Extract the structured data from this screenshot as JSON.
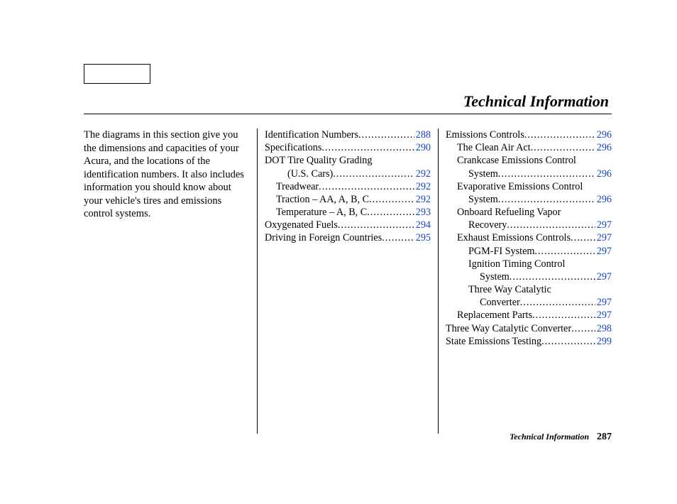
{
  "header": {
    "title": "Technical Information"
  },
  "intro": "The diagrams in this section give you the dimensions and capacities of your Acura, and the locations of the identification numbers. It also includes information you should know about your vehicle's tires and emissions control systems.",
  "col2": [
    {
      "label": "Identification Numbers",
      "page": "288",
      "indent": 0,
      "dots": true
    },
    {
      "label": "Specifications",
      "page": "290",
      "indent": 0,
      "dots": true
    },
    {
      "label": "DOT Tire Quality Grading",
      "page": "",
      "indent": 0,
      "dots": false
    },
    {
      "label": "(U.S. Cars)",
      "page": "292",
      "indent": 2,
      "dots": true
    },
    {
      "label": "Treadwear",
      "page": "292",
      "indent": 1,
      "dots": true
    },
    {
      "label": "Traction – AA, A, B, C",
      "page": "292",
      "indent": 1,
      "dots": true
    },
    {
      "label": "Temperature – A, B, C",
      "page": "293",
      "indent": 1,
      "dots": true
    },
    {
      "label": "Oxygenated Fuels",
      "page": "294",
      "indent": 0,
      "dots": true
    },
    {
      "label": "Driving in Foreign Countries",
      "page": "295",
      "indent": 0,
      "dots": true
    }
  ],
  "col3": [
    {
      "label": "Emissions Controls",
      "page": "296",
      "indent": 0,
      "dots": true
    },
    {
      "label": "The Clean Air Act",
      "page": "296",
      "indent": 1,
      "dots": true
    },
    {
      "label": "Crankcase Emissions Control",
      "page": "",
      "indent": 1,
      "dots": false
    },
    {
      "label": "System",
      "page": "296",
      "indent": 2,
      "dots": true
    },
    {
      "label": "Evaporative Emissions Control",
      "page": "",
      "indent": 1,
      "dots": false
    },
    {
      "label": "System",
      "page": "296",
      "indent": 2,
      "dots": true
    },
    {
      "label": "Onboard Refueling Vapor",
      "page": "",
      "indent": 1,
      "dots": false
    },
    {
      "label": "Recovery",
      "page": "297",
      "indent": 2,
      "dots": true
    },
    {
      "label": "Exhaust Emissions Controls",
      "page": "297",
      "indent": 1,
      "dots": true
    },
    {
      "label": "PGM-FI System",
      "page": "297",
      "indent": 2,
      "dots": true
    },
    {
      "label": "Ignition Timing Control",
      "page": "",
      "indent": 2,
      "dots": false
    },
    {
      "label": "System",
      "page": "297",
      "indent": 3,
      "dots": true
    },
    {
      "label": "Three Way Catalytic",
      "page": "",
      "indent": 2,
      "dots": false
    },
    {
      "label": "Converter",
      "page": "297",
      "indent": 3,
      "dots": true
    },
    {
      "label": "Replacement Parts",
      "page": "297",
      "indent": 1,
      "dots": true
    },
    {
      "label": "Three Way Catalytic Converter",
      "page": "298",
      "indent": 0,
      "dots": true
    },
    {
      "label": "State Emissions Testing",
      "page": "299",
      "indent": 0,
      "dots": true
    }
  ],
  "footer": {
    "label": "Technical Information",
    "page": "287"
  }
}
